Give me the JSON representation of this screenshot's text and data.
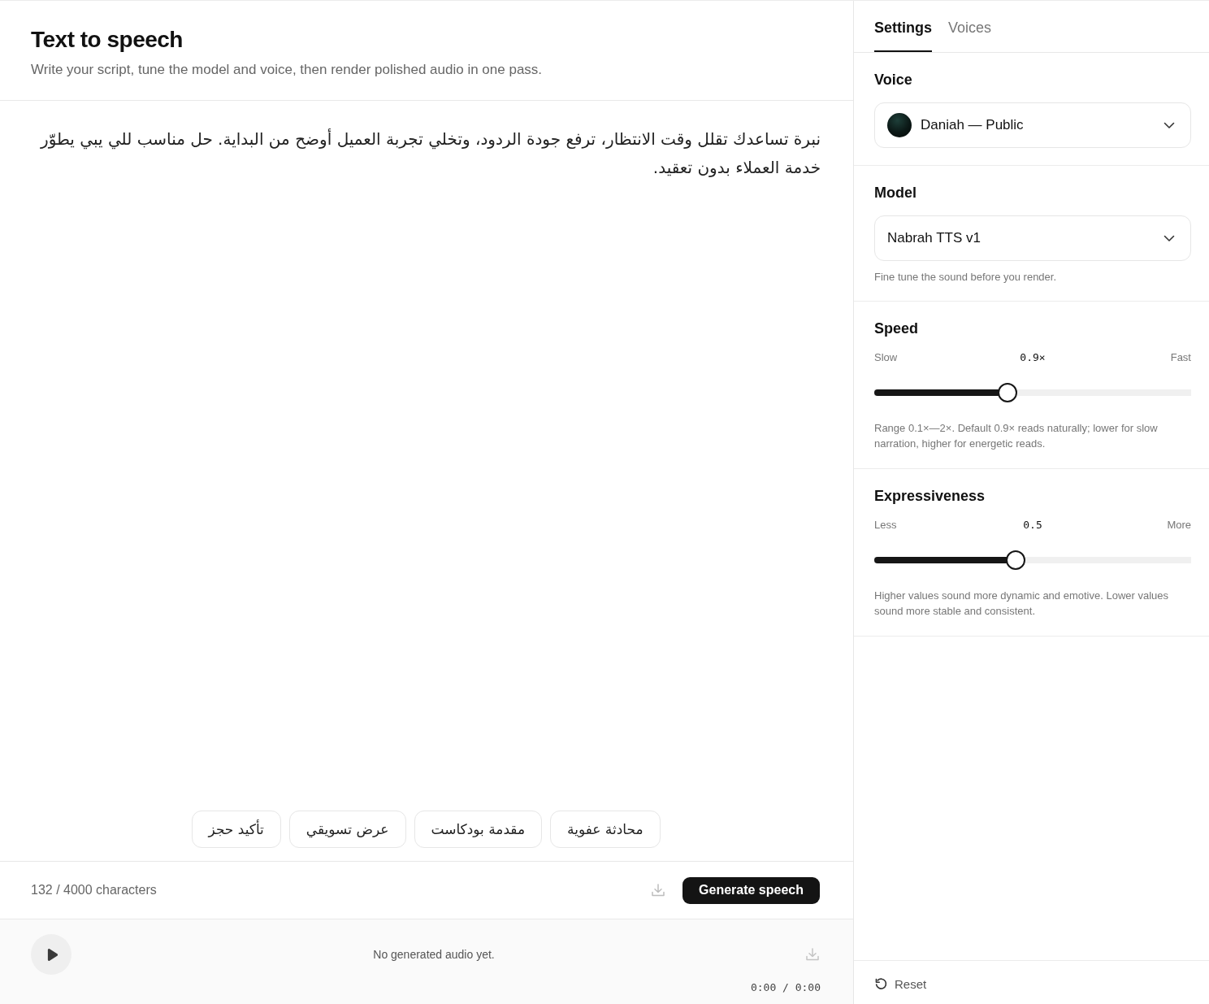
{
  "header": {
    "title": "Text to speech",
    "subtitle": "Write your script, tune the model and voice, then render polished audio in one pass."
  },
  "editor": {
    "value": "نبرة تساعدك تقلل وقت الانتظار، ترفع جودة الردود، وتخلي تجربة العميل أوضح من البداية. حل مناسب للي يبي يطوّر خدمة العملاء بدون تعقيد."
  },
  "presets": [
    "محادثة عفوية",
    "مقدمة بودكاست",
    "عرض تسويقي",
    "تأكيد حجز"
  ],
  "footer": {
    "char_count": "132 / 4000 characters",
    "generate_button": "Generate speech"
  },
  "player": {
    "status": "No generated audio yet.",
    "time": "0:00 / 0:00"
  },
  "sidebar": {
    "tabs": [
      {
        "label": "Settings",
        "selected": true
      },
      {
        "label": "Voices",
        "selected": false
      }
    ],
    "voice": {
      "title": "Voice",
      "value": "Daniah — Public"
    },
    "model": {
      "title": "Model",
      "value": "Nabrah TTS v1",
      "hint": "Fine tune the sound before you render."
    },
    "sliders": [
      {
        "title": "Speed",
        "min_label": "Slow",
        "reading": "0.9×",
        "max_label": "Fast",
        "level": 0.42,
        "help": "Range 0.1×—2×. Default 0.9× reads naturally; lower for slow narration, higher for energetic reads."
      },
      {
        "title": "Expressiveness",
        "min_label": "Less",
        "reading": "0.5",
        "max_label": "More",
        "level": 0.445,
        "help": "Higher values sound more dynamic and emotive. Lower values sound more stable and consistent."
      }
    ],
    "reset_button": "Reset"
  }
}
